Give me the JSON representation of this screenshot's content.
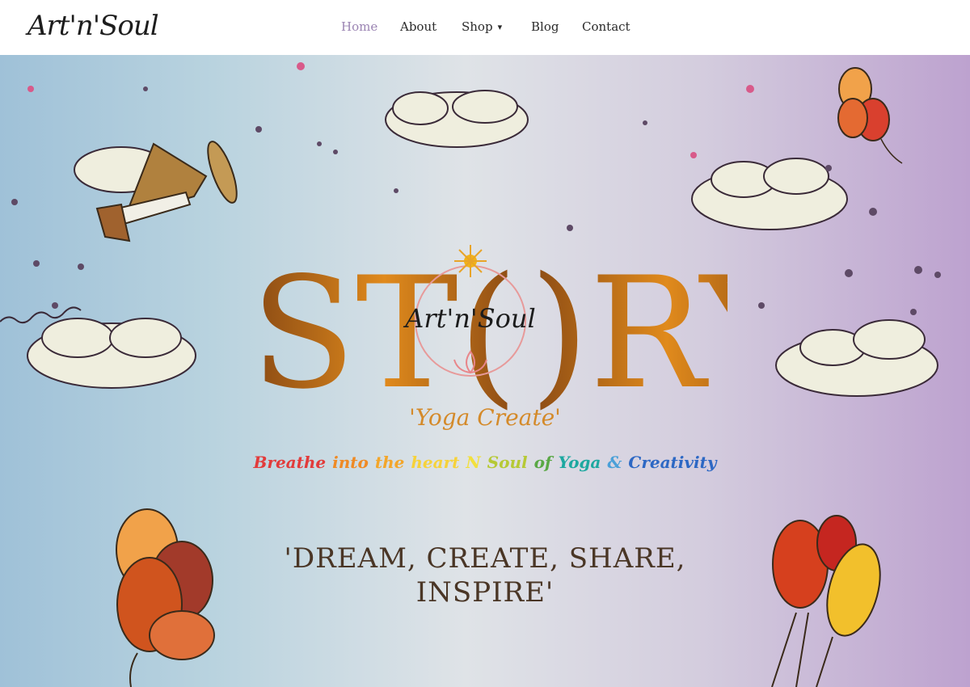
{
  "brand": {
    "logo_text": "Art'n'Soul"
  },
  "nav": {
    "items": [
      {
        "label": "Home",
        "active": true
      },
      {
        "label": "About"
      },
      {
        "label": "Shop",
        "has_dropdown": true,
        "chevron_icon": "chevron-down-icon"
      },
      {
        "label": "Blog"
      },
      {
        "label": "Contact"
      }
    ]
  },
  "hero": {
    "title_left": "ST(",
    "title_right": ")RY",
    "emblem_text": "Art'n'Soul",
    "subtitle": "'Yoga Create'",
    "tagline_words": [
      {
        "text": "Breathe",
        "color": "#e23b3b"
      },
      {
        "text": "into",
        "color": "#ef8a24"
      },
      {
        "text": "the",
        "color": "#f3a62a"
      },
      {
        "text": "heart",
        "color": "#f6d23a"
      },
      {
        "text": "N",
        "color": "#f2e03d"
      },
      {
        "text": "Soul",
        "color": "#b6c935"
      },
      {
        "text": "of",
        "color": "#5aa845"
      },
      {
        "text": "Yoga",
        "color": "#1da8a0"
      },
      {
        "text": "&",
        "color": "#4aa0d8"
      },
      {
        "text": "Creativity",
        "color": "#2d68c4"
      }
    ],
    "motto_line1": "'DREAM, CREATE, SHARE,",
    "motto_line2": "INSPIRE'"
  },
  "colors": {
    "title_orange": "#e08a1c",
    "title_brown": "#8a4a14",
    "title_gold": "#f2b416"
  }
}
